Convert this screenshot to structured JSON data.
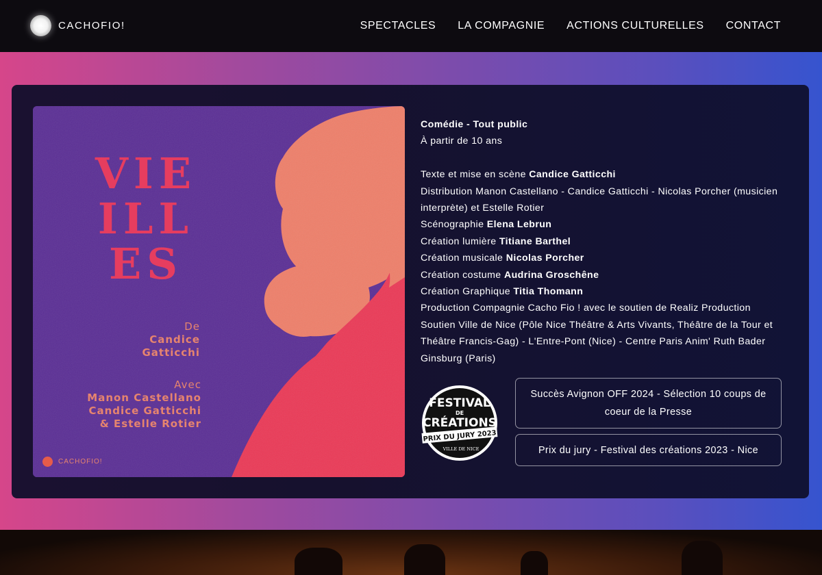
{
  "header": {
    "brand": "CACHOFIO!",
    "nav": [
      "SPECTACLES",
      "LA COMPAGNIE",
      "ACTIONS CULTURELLES",
      "CONTACT"
    ]
  },
  "poster": {
    "title_lines": [
      "VIE",
      "ILL",
      "ES"
    ],
    "author_label": "De",
    "author": [
      "Candice",
      "Gatticchi"
    ],
    "cast_label": "Avec",
    "cast": [
      "Manon Castellano",
      "Candice Gatticchi",
      "& Estelle Rotier"
    ],
    "logo": "CACHOFIO!"
  },
  "info": {
    "genre": "Comédie - Tout public",
    "age": "À partir de 10 ans",
    "text_label": "Texte et mise en scène",
    "text_value": "Candice Gatticchi",
    "distribution": "Distribution Manon Castellano - Candice Gatticchi - Nicolas Porcher (musicien interprète) et Estelle Rotier",
    "credits": [
      {
        "label": "Scénographie",
        "value": "Elena Lebrun"
      },
      {
        "label": "Création lumière",
        "value": "Titiane Barthel"
      },
      {
        "label": "Création musicale",
        "value": "Nicolas Porcher"
      },
      {
        "label": "Création costume",
        "value": "Audrina Groschêne"
      },
      {
        "label": "Création Graphique",
        "value": "Titia Thomann"
      }
    ],
    "production": "Production Compagnie Cacho Fio ! avec le soutien de Realiz Production",
    "support": "Soutien Ville de Nice (Pôle Nice Théâtre & Arts Vivants, Théâtre de la Tour et Théâtre Francis-Gag) - L'Entre-Pont (Nice) - Centre Paris Anim' Ruth Bader Ginsburg (Paris)"
  },
  "badge": {
    "line1": "FESTIVAL",
    "line2": "DE",
    "line3": "CRÉATIONS",
    "ribbon": "PRIX DU JURY 2023",
    "footer": "VILLE DE NICE"
  },
  "awards": [
    "Succès Avignon OFF 2024 - Sélection 10 coups de coeur de la Presse",
    "Prix du jury - Festival des créations 2023 - Nice"
  ],
  "colors": {
    "header_bg": "#0d0b10",
    "gradient_left": "#d6468a",
    "gradient_right": "#3654cf",
    "card_bg": "#16112e",
    "poster_purple": "#5b2f95",
    "poster_red": "#e63d5f",
    "poster_salmon": "#e6846e"
  }
}
